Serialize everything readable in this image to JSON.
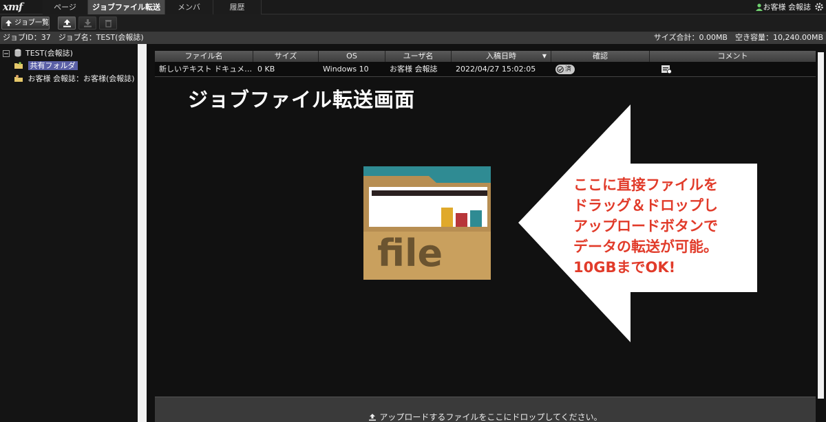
{
  "app": {
    "logo": "xmf"
  },
  "nav": {
    "tabs": [
      {
        "label": "ページ",
        "active": false
      },
      {
        "label": "ジョブファイル転送",
        "active": true
      },
      {
        "label": "メンバ",
        "active": false
      },
      {
        "label": "履歴",
        "active": false
      }
    ],
    "user": "お客様 会報誌"
  },
  "toolbar": {
    "job_list_label": "ジョブ一覧"
  },
  "info": {
    "job": "ジョブID：37　ジョブ名：TEST(会報誌)",
    "storage": "サイズ合計：0.00MB　空き容量：10,240.00MB"
  },
  "tree": {
    "root": "TEST(会報誌)",
    "shared": "共有フォルダ",
    "customer": "お客様 会報誌：お客様(会報誌)"
  },
  "grid": {
    "columns": [
      "ファイル名",
      "サイズ",
      "OS",
      "ユーザ名",
      "入稿日時",
      "確認",
      "コメント"
    ],
    "sort_indicator": "▼",
    "rows": [
      {
        "filename": "新しいテキスト ドキュメ…",
        "size": "0 KB",
        "os": "Windows 10",
        "user": "お客様 会報誌",
        "date": "2022/04/27 15:02:05",
        "confirm": "済"
      }
    ]
  },
  "annotation": {
    "heading": "ジョブファイル転送画面",
    "folder_label": "file",
    "callout": [
      "ここに直接ファイルを",
      "ドラッグ＆ドロップし",
      "アップロードボタンで",
      "データの転送が可能。",
      "10GBまでOK!"
    ]
  },
  "dropzone": {
    "text": "アップロードするファイルをここにドロップしてください。"
  },
  "colors": {
    "accent": "#5a5fa6",
    "callout_text": "#e13b2a",
    "folder": "#c9a05e",
    "folder_tab": "#2f8b93"
  }
}
